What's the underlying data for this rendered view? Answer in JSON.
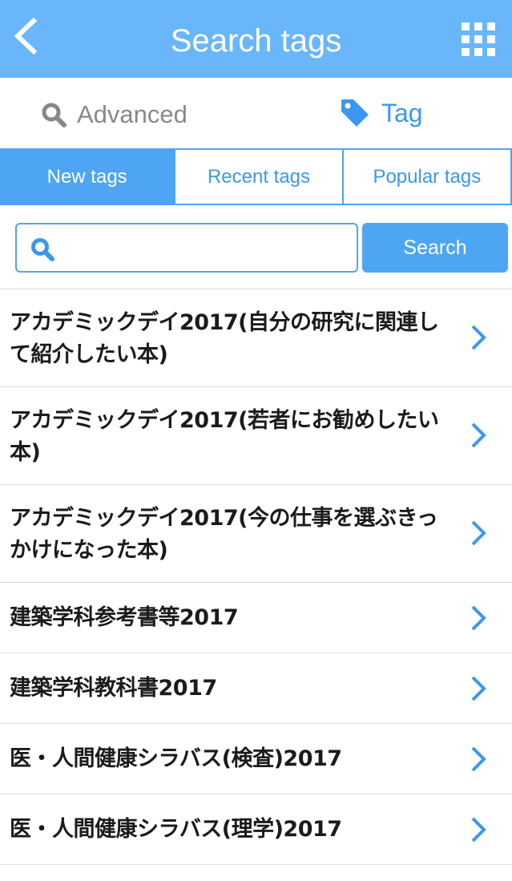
{
  "header": {
    "title": "Search tags",
    "back_icon": "chevron-left-icon",
    "menu_icon": "grid-menu-icon",
    "color": "#69b6fb"
  },
  "modes": {
    "advanced": {
      "label": "Advanced",
      "icon": "search-icon",
      "color": "#888888"
    },
    "tag": {
      "label": "Tag",
      "icon": "tag-icon",
      "color": "#3c97ee",
      "selected": true
    }
  },
  "tabs": [
    {
      "label": "New tags",
      "active": true
    },
    {
      "label": "Recent tags",
      "active": false
    },
    {
      "label": "Popular tags",
      "active": false
    }
  ],
  "search": {
    "placeholder": "",
    "value": "",
    "button_label": "Search",
    "icon": "search-icon"
  },
  "accent_color": "#4ea5f3",
  "tag_list": [
    "アカデミックデイ2017(自分の研究に関連して紹介したい本)",
    "アカデミックデイ2017(若者にお勧めしたい本)",
    "アカデミックデイ2017(今の仕事を選ぶきっかけになった本)",
    "建築学科参考書等2017",
    "建築学科教科書2017",
    "医・人間健康シラバス(検査)2017",
    "医・人間健康シラバス(理学)2017"
  ]
}
